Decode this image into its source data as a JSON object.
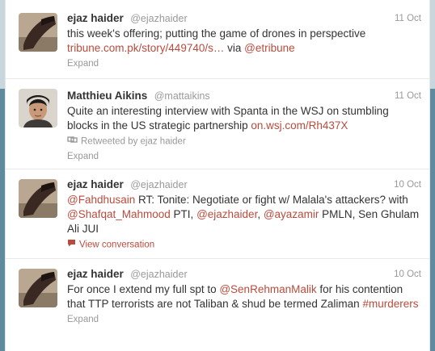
{
  "tweets": [
    {
      "name": "ejaz haider",
      "handle": "@ejazhaider",
      "date": "11 Oct",
      "text": [
        {
          "t": "this week's offering; putting the game of drones in perspective "
        },
        {
          "t": "tribune.com.pk/story/449740/s…",
          "link": true
        },
        {
          "t": " via "
        },
        {
          "t": "@etribune",
          "link": true
        }
      ],
      "action": "Expand"
    },
    {
      "name": "Matthieu Aikins",
      "handle": "@mattaikins",
      "date": "11 Oct",
      "text": [
        {
          "t": "Quite an interesting interview with Spanta in the WSJ on stumbling blocks in the US strategic partnership "
        },
        {
          "t": "on.wsj.com/Rh437X",
          "link": true
        }
      ],
      "retweeted_by": "Retweeted by ejaz haider",
      "action": "Expand"
    },
    {
      "name": "ejaz haider",
      "handle": "@ejazhaider",
      "date": "10 Oct",
      "text": [
        {
          "t": "@Fahdhusain",
          "link": true
        },
        {
          "t": " RT: Tonite: Negotiate or fight w/ Malala's attackers? with "
        },
        {
          "t": "@Shafqat_Mahmood",
          "link": true
        },
        {
          "t": " PTI, "
        },
        {
          "t": "@ejazhaider",
          "link": true
        },
        {
          "t": ", "
        },
        {
          "t": "@ayazamir",
          "link": true
        },
        {
          "t": " PMLN, Sen Ghulam Ali JUI"
        }
      ],
      "conversation": "View conversation"
    },
    {
      "name": "ejaz haider",
      "handle": "@ejazhaider",
      "date": "10 Oct",
      "text": [
        {
          "t": "For once I extend my full spt to "
        },
        {
          "t": "@SenRehmanMalik",
          "link": true
        },
        {
          "t": " for his contention that TTP terrorists are not Taliban & shud be termed Zaliman "
        },
        {
          "t": "#murderers",
          "link": true
        }
      ],
      "action": "Expand"
    }
  ]
}
